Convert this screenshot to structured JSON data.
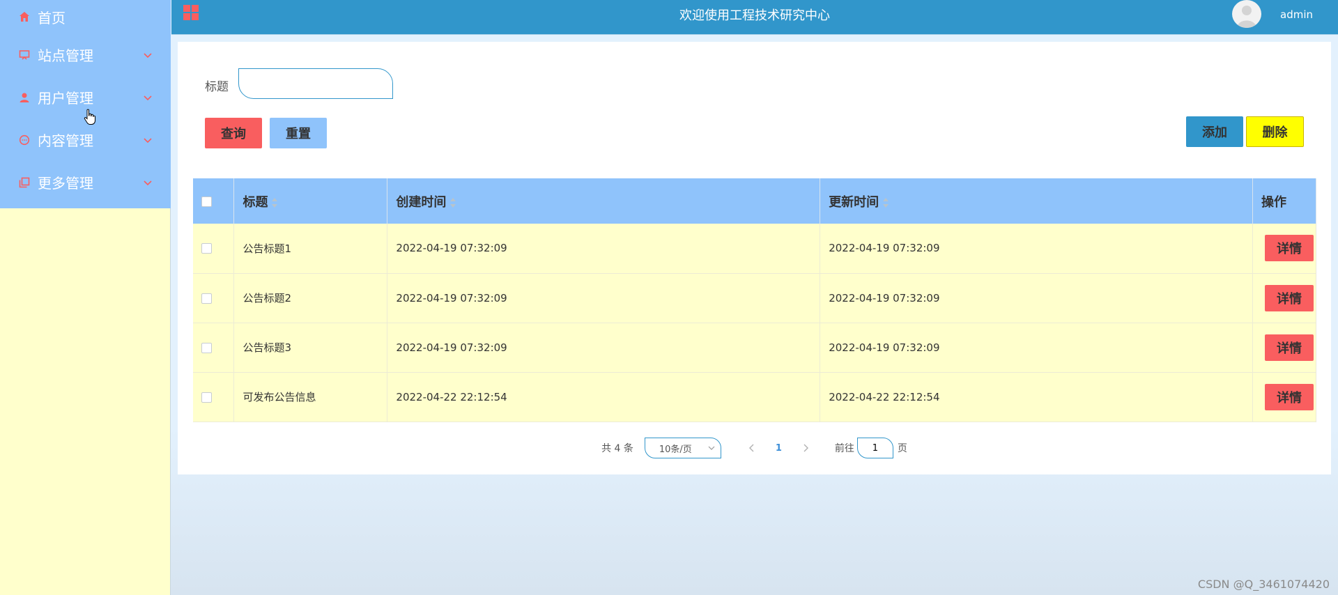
{
  "sidebar": {
    "items": [
      {
        "label": "首页",
        "icon": "home-icon"
      },
      {
        "label": "站点管理",
        "icon": "monitor-icon"
      },
      {
        "label": "用户管理",
        "icon": "user-icon"
      },
      {
        "label": "内容管理",
        "icon": "chat-icon"
      },
      {
        "label": "更多管理",
        "icon": "copy-icon"
      }
    ]
  },
  "header": {
    "title": "欢迎使用工程技术研究中心",
    "username": "admin"
  },
  "search": {
    "label": "标题",
    "placeholder": "",
    "query_label": "查询",
    "reset_label": "重置",
    "add_label": "添加",
    "delete_label": "删除"
  },
  "table": {
    "columns": [
      "标题",
      "创建时间",
      "更新时间",
      "操作"
    ],
    "rows": [
      {
        "title": "公告标题1",
        "created": "2022-04-19 07:32:09",
        "updated": "2022-04-19 07:32:09",
        "action": "详情"
      },
      {
        "title": "公告标题2",
        "created": "2022-04-19 07:32:09",
        "updated": "2022-04-19 07:32:09",
        "action": "详情"
      },
      {
        "title": "公告标题3",
        "created": "2022-04-19 07:32:09",
        "updated": "2022-04-19 07:32:09",
        "action": "详情"
      },
      {
        "title": "可发布公告信息",
        "created": "2022-04-22 22:12:54",
        "updated": "2022-04-22 22:12:54",
        "action": "详情"
      }
    ]
  },
  "pagination": {
    "total": "共 4 条",
    "page_size": "10条/页",
    "current_page": "1",
    "goto_label": "前往",
    "goto_value": "1",
    "page_unit": "页"
  },
  "watermark": "CSDN @Q_3461074420",
  "colors": {
    "sidebar_menu": "#8fc3fb",
    "sidebar_bg": "#ffffcc",
    "header": "#3196cb",
    "danger": "#f95e5f",
    "warning": "#ffff00"
  }
}
